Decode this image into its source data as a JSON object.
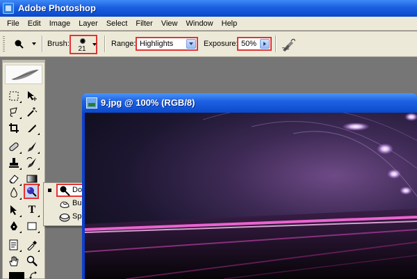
{
  "window": {
    "title": "Adobe Photoshop"
  },
  "menubar": {
    "items": [
      "File",
      "Edit",
      "Image",
      "Layer",
      "Select",
      "Filter",
      "View",
      "Window",
      "Help"
    ]
  },
  "options": {
    "brush_label": "Brush:",
    "brush_size": "21",
    "range_label": "Range:",
    "range_value": "Highlights",
    "exposure_label": "Exposure:",
    "exposure_value": "50%"
  },
  "flyout": {
    "items": [
      {
        "label": "Dodge Tool",
        "selected": true,
        "highlighted": true
      },
      {
        "label": "Burn Tool",
        "selected": false
      },
      {
        "label": "Sponge Tool",
        "selected": false
      }
    ]
  },
  "document": {
    "title": "9.jpg @ 100% (RGB/8)"
  },
  "colors": {
    "highlight_red": "#e23333",
    "xp_blue": "#0a48c9",
    "panel": "#ece9d8",
    "canvas_purple": "#6e4a86"
  },
  "toolbox": {
    "tools": [
      "marquee-icon",
      "move-icon",
      "lasso-icon",
      "magic-wand-icon",
      "crop-icon",
      "slice-icon",
      "healing-brush-icon",
      "brush-icon",
      "clone-stamp-icon",
      "history-brush-icon",
      "eraser-icon",
      "gradient-icon",
      "blur-icon",
      "dodge-icon",
      "path-selection-icon",
      "text-icon",
      "pen-icon",
      "rectangle-icon",
      "notes-icon",
      "eyedropper-icon",
      "hand-icon",
      "zoom-icon"
    ],
    "text_tool_glyph": "T"
  }
}
